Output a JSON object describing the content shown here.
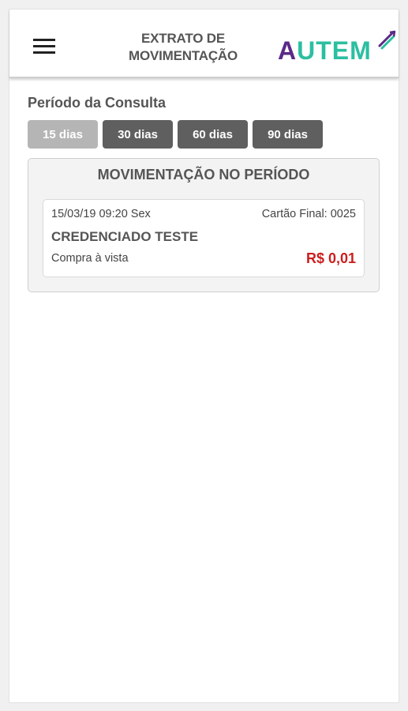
{
  "header": {
    "title_line1": "EXTRATO DE",
    "title_line2": "MOVIMENTAÇÃO",
    "menu_icon": "hamburger-menu-icon",
    "logo": {
      "text_first": "A",
      "text_rest": "UTEM",
      "color_primary": "#5b2a86",
      "color_secondary": "#2bbfa0"
    }
  },
  "period": {
    "label": "Período da Consulta",
    "options": [
      {
        "label": "15 dias",
        "active": true
      },
      {
        "label": "30 dias",
        "active": false
      },
      {
        "label": "60 dias",
        "active": false
      },
      {
        "label": "90 dias",
        "active": false
      }
    ]
  },
  "movements": {
    "title": "MOVIMENTAÇÃO NO PERÍODO",
    "items": [
      {
        "datetime": "15/03/19 09:20 Sex",
        "card": "Cartão Final: 0025",
        "merchant": "CREDENCIADO TESTE",
        "type": "Compra à vista",
        "amount": "R$ 0,01",
        "amount_color": "#cc1e1e"
      }
    ]
  }
}
